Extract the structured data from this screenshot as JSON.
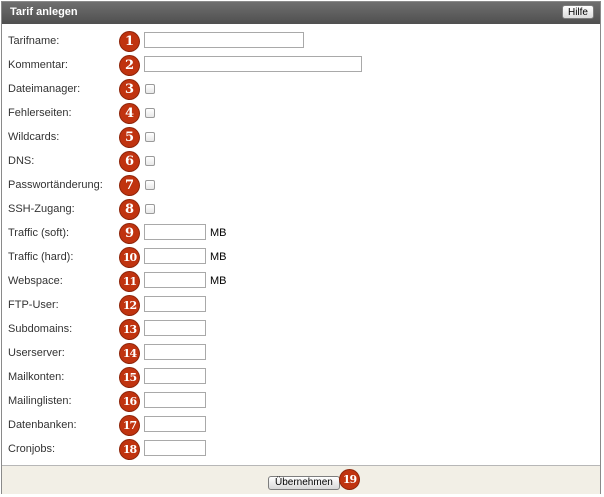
{
  "header": {
    "title": "Tarif anlegen",
    "help_label": "Hilfe"
  },
  "fields": [
    {
      "label": "Tarifname:",
      "number": "1",
      "type": "text",
      "width": "wide",
      "value": ""
    },
    {
      "label": "Kommentar:",
      "number": "2",
      "type": "text",
      "width": "wider",
      "value": ""
    },
    {
      "label": "Dateimanager:",
      "number": "3",
      "type": "checkbox",
      "checked": false
    },
    {
      "label": "Fehlerseiten:",
      "number": "4",
      "type": "checkbox",
      "checked": false
    },
    {
      "label": "Wildcards:",
      "number": "5",
      "type": "checkbox",
      "checked": false
    },
    {
      "label": "DNS:",
      "number": "6",
      "type": "checkbox",
      "checked": false
    },
    {
      "label": "Passwortänderung:",
      "number": "7",
      "type": "checkbox",
      "checked": false
    },
    {
      "label": "SSH-Zugang:",
      "number": "8",
      "type": "checkbox",
      "checked": false
    },
    {
      "label": "Traffic (soft):",
      "number": "9",
      "type": "text",
      "width": "short",
      "unit": "MB",
      "value": ""
    },
    {
      "label": "Traffic (hard):",
      "number": "10",
      "type": "text",
      "width": "short",
      "unit": "MB",
      "value": ""
    },
    {
      "label": "Webspace:",
      "number": "11",
      "type": "text",
      "width": "short",
      "unit": "MB",
      "value": ""
    },
    {
      "label": "FTP-User:",
      "number": "12",
      "type": "text",
      "width": "short",
      "value": ""
    },
    {
      "label": "Subdomains:",
      "number": "13",
      "type": "text",
      "width": "short",
      "value": ""
    },
    {
      "label": "Userserver:",
      "number": "14",
      "type": "text",
      "width": "short",
      "value": ""
    },
    {
      "label": "Mailkonten:",
      "number": "15",
      "type": "text",
      "width": "short",
      "value": ""
    },
    {
      "label": "Mailinglisten:",
      "number": "16",
      "type": "text",
      "width": "short",
      "value": ""
    },
    {
      "label": "Datenbanken:",
      "number": "17",
      "type": "text",
      "width": "short",
      "value": ""
    },
    {
      "label": "Cronjobs:",
      "number": "18",
      "type": "text",
      "width": "short",
      "value": ""
    }
  ],
  "footer": {
    "submit_label": "Übernehmen",
    "submit_number": "19"
  },
  "colors": {
    "badge": "#c0330f",
    "titlebar": "#5a5a5a",
    "footer": "#f2efe6"
  }
}
